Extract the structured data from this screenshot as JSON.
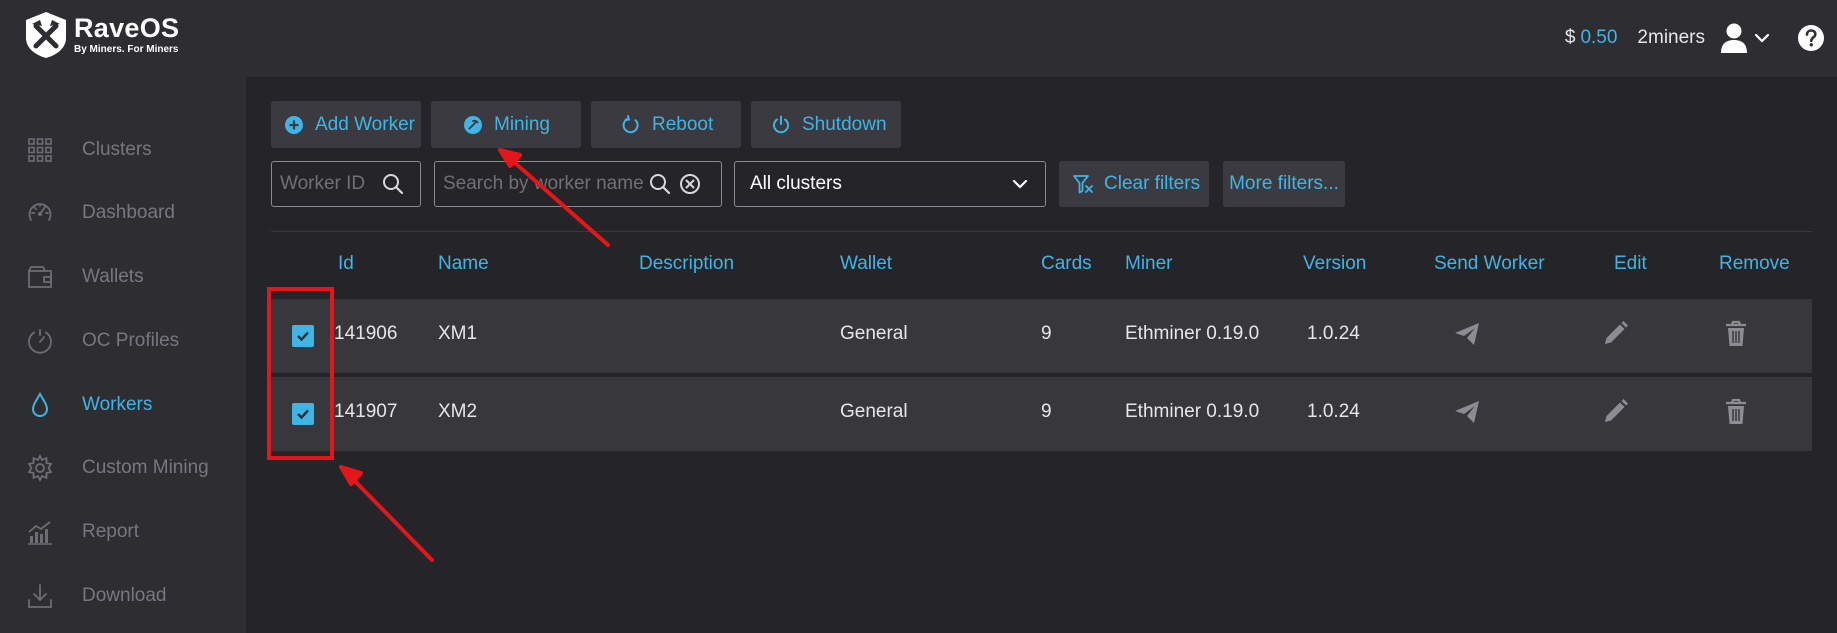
{
  "app": {
    "logo_title": "RaveOS",
    "logo_subtitle": "By Miners. For Miners"
  },
  "header": {
    "currency_symbol": "$",
    "balance": "0.50",
    "username": "2miners",
    "icons": [
      "user-icon",
      "chevron-down-icon",
      "help-icon"
    ]
  },
  "sidebar": {
    "items": [
      {
        "label": "Clusters",
        "icon": "grid-icon",
        "active": false
      },
      {
        "label": "Dashboard",
        "icon": "speedometer-icon",
        "active": false
      },
      {
        "label": "Wallets",
        "icon": "wallet-icon",
        "active": false
      },
      {
        "label": "OC Profiles",
        "icon": "gauge-icon",
        "active": false
      },
      {
        "label": "Workers",
        "icon": "drop-icon",
        "active": true
      },
      {
        "label": "Custom Mining",
        "icon": "gear-icon",
        "active": false
      },
      {
        "label": "Report",
        "icon": "chart-icon",
        "active": false
      },
      {
        "label": "Download",
        "icon": "download-icon",
        "active": false
      }
    ]
  },
  "toolbar": {
    "add_worker": "Add Worker",
    "mining": "Mining",
    "reboot": "Reboot",
    "shutdown": "Shutdown"
  },
  "filters": {
    "worker_id_placeholder": "Worker ID",
    "worker_name_placeholder": "Search by worker name",
    "cluster_selected": "All clusters",
    "clear_filters": "Clear filters",
    "more_filters": "More filters..."
  },
  "table": {
    "columns": [
      "Id",
      "Name",
      "Description",
      "Wallet",
      "Cards",
      "Miner",
      "Version",
      "Send Worker",
      "Edit",
      "Remove"
    ],
    "rows": [
      {
        "checked": true,
        "id": "141906",
        "name": "XM1",
        "description": "",
        "wallet": "General",
        "cards": "9",
        "miner": "Ethminer 0.19.0",
        "version": "1.0.24"
      },
      {
        "checked": true,
        "id": "141907",
        "name": "XM2",
        "description": "",
        "wallet": "General",
        "cards": "9",
        "miner": "Ethminer 0.19.0",
        "version": "1.0.24"
      }
    ]
  },
  "colors": {
    "accent": "#3fb5e6",
    "annotation": "#e4161b",
    "background": "#252529",
    "panel": "#2d2d32"
  }
}
